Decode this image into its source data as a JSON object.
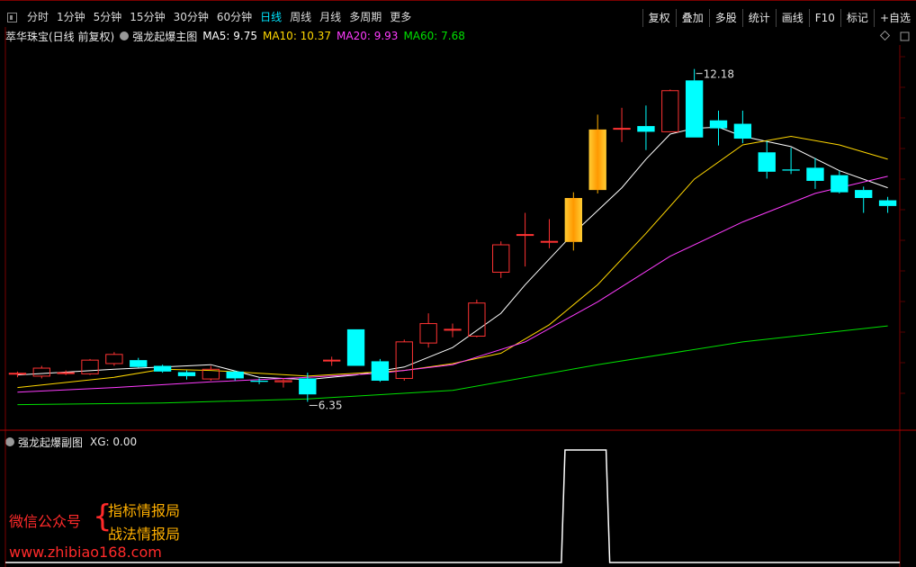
{
  "toolbar": {
    "periods": [
      "分时",
      "1分钟",
      "5分钟",
      "15分钟",
      "30分钟",
      "60分钟",
      "日线",
      "周线",
      "月线",
      "多周期",
      "更多"
    ],
    "active_period": "日线",
    "right_tools": [
      "复权",
      "叠加",
      "多股",
      "统计",
      "画线",
      "F10",
      "标记",
      "+自选"
    ]
  },
  "main_panel": {
    "stock": "萃华珠宝(日线 前复权)",
    "indicator": "强龙起爆主图",
    "ma": [
      {
        "label": "MA5: 9.75",
        "color": "#ffffff"
      },
      {
        "label": "MA10: 10.37",
        "color": "#ffd700"
      },
      {
        "label": "MA20: 9.93",
        "color": "#ff3cff"
      },
      {
        "label": "MA60: 7.68",
        "color": "#00e000"
      }
    ],
    "high_label": "12.18",
    "low_label": "6.35"
  },
  "sub_panel": {
    "indicator": "强龙起爆副图",
    "value": "XG: 0.00"
  },
  "watermark": {
    "line1": "微信公众号",
    "brace": "{",
    "line2": "指标情报局",
    "line3": "战法情报局",
    "url": "www.zhibiao168.com"
  },
  "colors": {
    "up": "#ff3333",
    "down": "#00ffff",
    "strong": "#ffb000",
    "grid": "#550000"
  },
  "chart_data": {
    "type": "candlestick",
    "price_ylim": [
      5.9,
      12.6
    ],
    "candles": [
      {
        "o": 6.85,
        "h": 6.88,
        "l": 6.78,
        "c": 6.85
      },
      {
        "o": 6.8,
        "h": 6.98,
        "l": 6.76,
        "c": 6.94
      },
      {
        "o": 6.86,
        "h": 6.9,
        "l": 6.82,
        "c": 6.86
      },
      {
        "o": 6.84,
        "h": 7.1,
        "l": 6.82,
        "c": 7.08
      },
      {
        "o": 7.02,
        "h": 7.22,
        "l": 6.98,
        "c": 7.18
      },
      {
        "o": 7.08,
        "h": 7.12,
        "l": 6.95,
        "c": 6.96
      },
      {
        "o": 6.98,
        "h": 7.0,
        "l": 6.86,
        "c": 6.88
      },
      {
        "o": 6.87,
        "h": 6.9,
        "l": 6.74,
        "c": 6.8
      },
      {
        "o": 6.75,
        "h": 6.98,
        "l": 6.72,
        "c": 6.92
      },
      {
        "o": 6.88,
        "h": 6.9,
        "l": 6.72,
        "c": 6.76
      },
      {
        "o": 6.72,
        "h": 6.76,
        "l": 6.66,
        "c": 6.7
      },
      {
        "o": 6.7,
        "h": 6.76,
        "l": 6.6,
        "c": 6.72
      },
      {
        "o": 6.76,
        "h": 6.86,
        "l": 6.35,
        "c": 6.48
      },
      {
        "o": 7.08,
        "h": 7.14,
        "l": 6.98,
        "c": 7.08
      },
      {
        "o": 7.62,
        "h": 7.62,
        "l": 6.98,
        "c": 6.98
      },
      {
        "o": 7.06,
        "h": 7.1,
        "l": 6.7,
        "c": 6.72
      },
      {
        "o": 6.76,
        "h": 7.44,
        "l": 6.72,
        "c": 7.4
      },
      {
        "o": 7.38,
        "h": 7.9,
        "l": 7.3,
        "c": 7.72
      },
      {
        "o": 7.62,
        "h": 7.72,
        "l": 7.48,
        "c": 7.62
      },
      {
        "o": 7.5,
        "h": 8.14,
        "l": 7.48,
        "c": 8.08
      },
      {
        "o": 8.62,
        "h": 9.16,
        "l": 8.52,
        "c": 9.1
      },
      {
        "o": 9.28,
        "h": 9.66,
        "l": 8.72,
        "c": 9.28
      },
      {
        "o": 9.16,
        "h": 9.55,
        "l": 9.04,
        "c": 9.16
      },
      {
        "o": 9.15,
        "h": 10.02,
        "l": 9.0,
        "c": 9.92
      },
      {
        "o": 10.06,
        "h": 11.38,
        "l": 10.0,
        "c": 11.12
      },
      {
        "o": 11.14,
        "h": 11.5,
        "l": 10.9,
        "c": 11.14
      },
      {
        "o": 11.18,
        "h": 11.54,
        "l": 10.76,
        "c": 11.08
      },
      {
        "o": 11.08,
        "h": 11.82,
        "l": 11.08,
        "c": 11.8
      },
      {
        "o": 11.98,
        "h": 12.18,
        "l": 10.98,
        "c": 10.98
      },
      {
        "o": 11.28,
        "h": 11.45,
        "l": 10.84,
        "c": 11.14
      },
      {
        "o": 11.22,
        "h": 11.45,
        "l": 10.88,
        "c": 10.96
      },
      {
        "o": 10.72,
        "h": 10.92,
        "l": 10.26,
        "c": 10.38
      },
      {
        "o": 10.42,
        "h": 10.8,
        "l": 10.34,
        "c": 10.4
      },
      {
        "o": 10.45,
        "h": 10.62,
        "l": 10.08,
        "c": 10.22
      },
      {
        "o": 10.32,
        "h": 10.4,
        "l": 10.0,
        "c": 10.02
      },
      {
        "o": 10.06,
        "h": 10.12,
        "l": 9.66,
        "c": 9.92
      },
      {
        "o": 9.88,
        "h": 9.94,
        "l": 9.66,
        "c": 9.78
      }
    ],
    "candle_style": [
      "n",
      "n",
      "n",
      "n",
      "n",
      "n",
      "n",
      "n",
      "n",
      "n",
      "n",
      "n",
      "n",
      "n",
      "n",
      "n",
      "n",
      "n",
      "n",
      "n",
      "n",
      "n",
      "n",
      "s",
      "s",
      "n",
      "n",
      "n",
      "n",
      "n",
      "n",
      "n",
      "n",
      "n",
      "n",
      "n",
      "n"
    ],
    "ma_series": [
      {
        "name": "MA5",
        "color": "#ffffff",
        "points": [
          [
            0,
            6.82
          ],
          [
            4,
            6.92
          ],
          [
            8,
            7.0
          ],
          [
            10,
            6.78
          ],
          [
            12,
            6.74
          ],
          [
            14,
            6.82
          ],
          [
            16,
            6.96
          ],
          [
            18,
            7.3
          ],
          [
            20,
            7.9
          ],
          [
            21,
            8.4
          ],
          [
            23,
            9.3
          ],
          [
            25,
            10.1
          ],
          [
            26,
            10.6
          ],
          [
            27,
            11.04
          ],
          [
            28,
            11.14
          ],
          [
            29,
            11.16
          ],
          [
            30,
            11.0
          ],
          [
            32,
            10.82
          ],
          [
            34,
            10.4
          ],
          [
            36,
            10.1
          ]
        ]
      },
      {
        "name": "MA10",
        "color": "#ffd700",
        "points": [
          [
            0,
            6.6
          ],
          [
            4,
            6.78
          ],
          [
            6,
            6.92
          ],
          [
            8,
            6.9
          ],
          [
            12,
            6.8
          ],
          [
            14,
            6.85
          ],
          [
            16,
            6.9
          ],
          [
            18,
            7.02
          ],
          [
            20,
            7.2
          ],
          [
            22,
            7.7
          ],
          [
            24,
            8.4
          ],
          [
            26,
            9.3
          ],
          [
            28,
            10.25
          ],
          [
            30,
            10.85
          ],
          [
            32,
            11.0
          ],
          [
            34,
            10.85
          ],
          [
            36,
            10.6
          ]
        ]
      },
      {
        "name": "MA20",
        "color": "#ff3cff",
        "points": [
          [
            0,
            6.52
          ],
          [
            4,
            6.6
          ],
          [
            8,
            6.7
          ],
          [
            12,
            6.78
          ],
          [
            15,
            6.85
          ],
          [
            18,
            7.0
          ],
          [
            21,
            7.4
          ],
          [
            24,
            8.1
          ],
          [
            27,
            8.9
          ],
          [
            30,
            9.5
          ],
          [
            33,
            10.0
          ],
          [
            36,
            10.3
          ]
        ]
      },
      {
        "name": "MA60",
        "color": "#00e000",
        "points": [
          [
            0,
            6.3
          ],
          [
            6,
            6.33
          ],
          [
            12,
            6.4
          ],
          [
            18,
            6.55
          ],
          [
            24,
            7.0
          ],
          [
            30,
            7.4
          ],
          [
            36,
            7.68
          ]
        ]
      }
    ],
    "xg_signal": [
      0,
      0,
      0,
      0,
      0,
      0,
      0,
      0,
      0,
      0,
      0,
      0,
      0,
      0,
      0,
      0,
      0,
      0,
      0,
      0,
      0,
      0,
      0,
      1,
      1,
      0,
      0,
      0,
      0,
      0,
      0,
      0,
      0,
      0,
      0,
      0,
      0
    ],
    "xg_ylim": [
      0,
      1
    ]
  }
}
